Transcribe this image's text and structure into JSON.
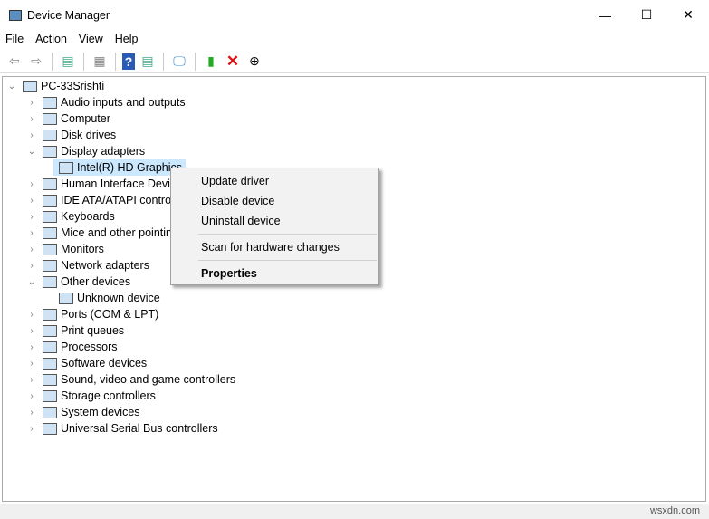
{
  "window": {
    "title": "Device Manager",
    "minimize": "—",
    "maximize": "☐",
    "close": "✕"
  },
  "menu": [
    "File",
    "Action",
    "View",
    "Help"
  ],
  "toolbar": {
    "icons": [
      "back-icon",
      "forward-icon",
      "show-hide-console-tree-icon",
      "properties-icon",
      "help-icon",
      "action-pane-icon",
      "scan-hardware-icon",
      "update-driver-icon",
      "uninstall-icon",
      "disable-icon"
    ]
  },
  "tree": {
    "root": "PC-33Srishti",
    "items": [
      {
        "label": "Audio inputs and outputs",
        "expanded": false
      },
      {
        "label": "Computer",
        "expanded": false
      },
      {
        "label": "Disk drives",
        "expanded": false
      },
      {
        "label": "Display adapters",
        "expanded": true,
        "children": [
          "Intel(R) HD Graphics"
        ]
      },
      {
        "label": "Human Interface Devices",
        "expanded": false
      },
      {
        "label": "IDE ATA/ATAPI controllers",
        "expanded": false
      },
      {
        "label": "Keyboards",
        "expanded": false
      },
      {
        "label": "Mice and other pointing devices",
        "expanded": false
      },
      {
        "label": "Monitors",
        "expanded": false
      },
      {
        "label": "Network adapters",
        "expanded": false
      },
      {
        "label": "Other devices",
        "expanded": true,
        "children": [
          "Unknown device"
        ]
      },
      {
        "label": "Ports (COM & LPT)",
        "expanded": false
      },
      {
        "label": "Print queues",
        "expanded": false
      },
      {
        "label": "Processors",
        "expanded": false
      },
      {
        "label": "Software devices",
        "expanded": false
      },
      {
        "label": "Sound, video and game controllers",
        "expanded": false
      },
      {
        "label": "Storage controllers",
        "expanded": false
      },
      {
        "label": "System devices",
        "expanded": false
      },
      {
        "label": "Universal Serial Bus controllers",
        "expanded": false
      }
    ]
  },
  "context_menu": {
    "update": "Update driver",
    "disable": "Disable device",
    "uninstall": "Uninstall device",
    "scan": "Scan for hardware changes",
    "properties": "Properties"
  },
  "watermark": "wsxdn.com"
}
